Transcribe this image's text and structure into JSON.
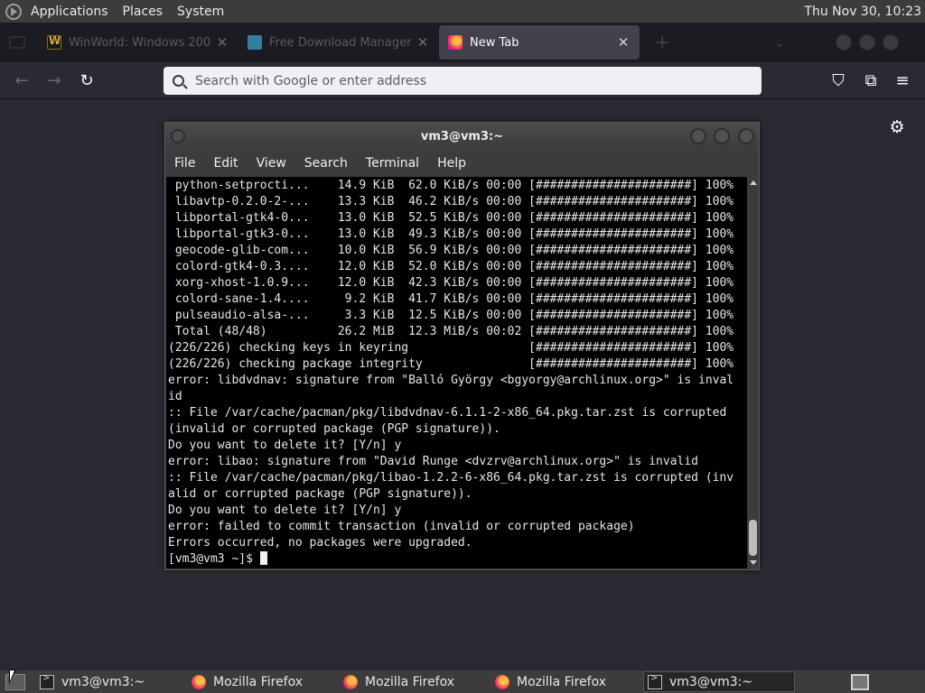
{
  "top_panel": {
    "menus": [
      "Applications",
      "Places",
      "System"
    ],
    "clock": "Thu Nov 30, 10:23"
  },
  "browser": {
    "tabs": [
      {
        "title": "WinWorld: Windows 200",
        "icon": "winworld-icon",
        "active": false
      },
      {
        "title": "Free Download Manager",
        "icon": "fdm-icon",
        "active": false
      },
      {
        "title": "New Tab",
        "icon": "firefox-icon",
        "active": true
      }
    ],
    "address_placeholder": "Search with Google or enter address"
  },
  "terminal": {
    "title": "vm3@vm3:~",
    "menu": [
      "File",
      "Edit",
      "View",
      "Search",
      "Terminal",
      "Help"
    ],
    "lines": [
      " python-setprocti...    14.9 KiB  62.0 KiB/s 00:00 [######################] 100%",
      " libavtp-0.2.0-2-...    13.3 KiB  46.2 KiB/s 00:00 [######################] 100%",
      " libportal-gtk4-0...    13.0 KiB  52.5 KiB/s 00:00 [######################] 100%",
      " libportal-gtk3-0...    13.0 KiB  49.3 KiB/s 00:00 [######################] 100%",
      " geocode-glib-com...    10.0 KiB  56.9 KiB/s 00:00 [######################] 100%",
      " colord-gtk4-0.3....    12.0 KiB  52.0 KiB/s 00:00 [######################] 100%",
      " xorg-xhost-1.0.9...    12.0 KiB  42.3 KiB/s 00:00 [######################] 100%",
      " colord-sane-1.4....     9.2 KiB  41.7 KiB/s 00:00 [######################] 100%",
      " pulseaudio-alsa-...     3.3 KiB  12.5 KiB/s 00:00 [######################] 100%",
      " Total (48/48)          26.2 MiB  12.3 MiB/s 00:02 [######################] 100%",
      "(226/226) checking keys in keyring                 [######################] 100%",
      "(226/226) checking package integrity               [######################] 100%",
      "error: libdvdnav: signature from \"Balló György <bgyorgy@archlinux.org>\" is inval",
      "id",
      ":: File /var/cache/pacman/pkg/libdvdnav-6.1.1-2-x86_64.pkg.tar.zst is corrupted",
      "(invalid or corrupted package (PGP signature)).",
      "Do you want to delete it? [Y/n] y",
      "error: libao: signature from \"David Runge <dvzrv@archlinux.org>\" is invalid",
      ":: File /var/cache/pacman/pkg/libao-1.2.2-6-x86_64.pkg.tar.zst is corrupted (inv",
      "alid or corrupted package (PGP signature)).",
      "Do you want to delete it? [Y/n] y",
      "error: failed to commit transaction (invalid or corrupted package)",
      "Errors occurred, no packages were upgraded."
    ],
    "prompt": "[vm3@vm3 ~]$ "
  },
  "taskbar": {
    "tasks": [
      {
        "label": "vm3@vm3:~",
        "icon": "terminal-icon",
        "active": false
      },
      {
        "label": "Mozilla Firefox",
        "icon": "firefox-icon",
        "active": false
      },
      {
        "label": "Mozilla Firefox",
        "icon": "firefox-icon",
        "active": false
      },
      {
        "label": "Mozilla Firefox",
        "icon": "firefox-icon",
        "active": false
      },
      {
        "label": "vm3@vm3:~",
        "icon": "terminal-icon",
        "active": true
      }
    ]
  }
}
